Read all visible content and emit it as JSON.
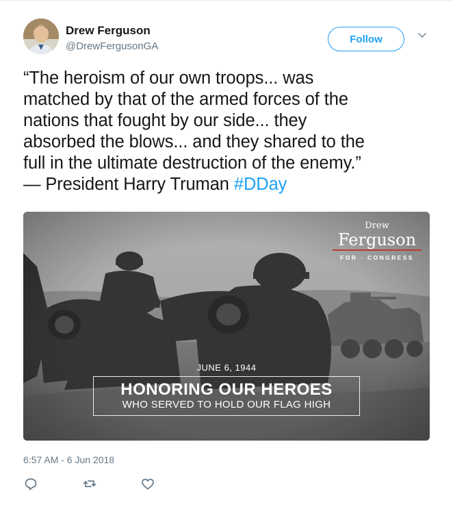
{
  "user": {
    "display_name": "Drew Ferguson",
    "handle": "@DrewFergusonGA",
    "avatar_icon": "user-avatar"
  },
  "follow_label": "Follow",
  "tweet": {
    "text": "“The heroism of our own troops... was\nmatched by that of the armed forces of the\nnations that fought by our side... they\nabsorbed the blows... and they shared to the\nfull in the ultimate destruction of the enemy.”\n— President Harry Truman  ",
    "hashtag": "#DDay",
    "timestamp": "6:57 AM - 6 Jun 2018"
  },
  "media": {
    "brand_top": "Drew",
    "brand_main": "Ferguson",
    "brand_sub": "FOR · CONGRESS",
    "date": "JUNE 6, 1944",
    "headline": "HONORING OUR HEROES",
    "subline": "WHO SERVED TO HOLD OUR FLAG HIGH"
  },
  "actions": [
    {
      "name": "reply",
      "icon": "reply-icon"
    },
    {
      "name": "retweet",
      "icon": "retweet-icon"
    },
    {
      "name": "like",
      "icon": "heart-icon"
    }
  ],
  "colors": {
    "accent": "#1da1f2",
    "text": "#14171a",
    "muted": "#657786",
    "brand_rule": "#c0392b"
  }
}
